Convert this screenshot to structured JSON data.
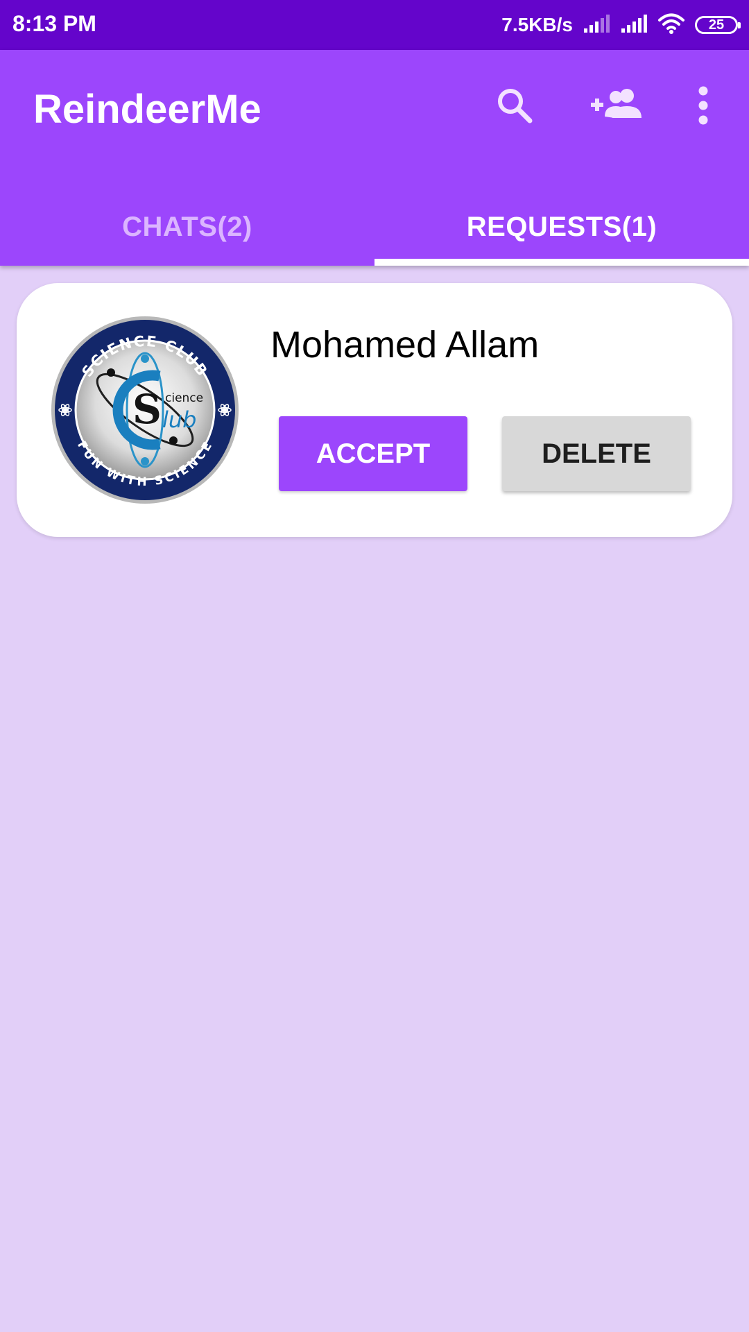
{
  "status_bar": {
    "time": "8:13 PM",
    "net_speed": "7.5KB/s",
    "battery": "25",
    "icons": [
      "signal-weak-icon",
      "signal-icon",
      "wifi-icon",
      "battery-icon"
    ]
  },
  "app_bar": {
    "title": "ReindeerMe",
    "actions": [
      "search-icon",
      "add-friend-icon",
      "more-vert-icon"
    ]
  },
  "tabs": [
    {
      "label": "CHATS(2)",
      "active": false
    },
    {
      "label": "REQUESTS(1)",
      "active": true
    }
  ],
  "requests": [
    {
      "name": "Mohamed Allam",
      "avatar": {
        "top_text": "SCIENCE CLUB",
        "bottom_text": "FUN WITH SCIENCE",
        "logo_text": "Science Club"
      },
      "accept_label": "ACCEPT",
      "delete_label": "DELETE"
    }
  ],
  "colors": {
    "status_bar": "#6405cb",
    "primary": "#9c46fc",
    "background": "#e2cff8",
    "tab_inactive": "#dbb5ff",
    "delete_button": "#d8d8d8"
  }
}
